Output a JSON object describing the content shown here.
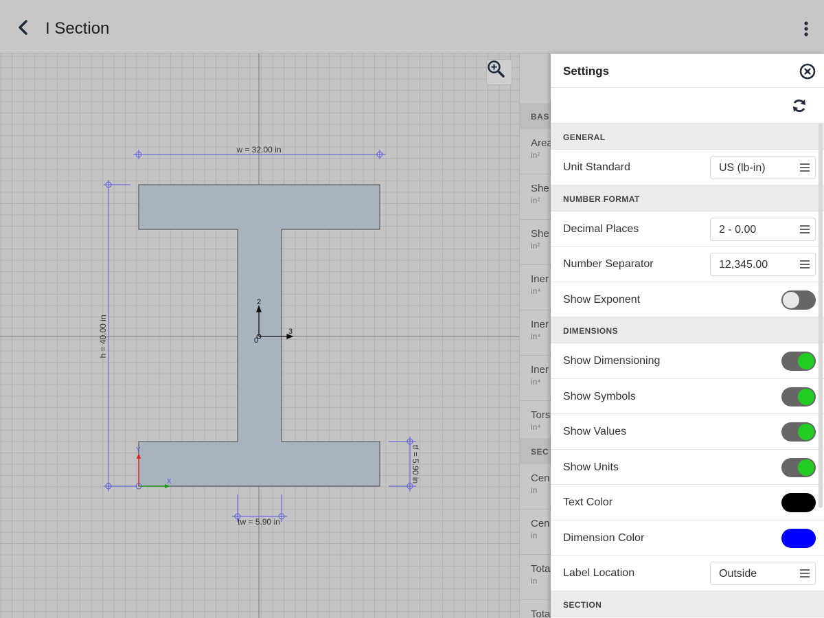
{
  "app": {
    "title": "I Section"
  },
  "colors": {
    "toggle_on": "#22cc22",
    "text_color": "#000000",
    "dimension_color": "#0000ff",
    "section_fill": "#a9b3be",
    "dimension_line": "#5a5adc"
  },
  "canvas": {
    "width_label": "w = 32.00 in",
    "height_label": "h = 40.00 in",
    "tf_label": "tf = 5.90 in",
    "tw_label": "tw = 5.90 in",
    "axis_2": "2",
    "axis_3": "3",
    "origin_label": "0",
    "local_y": "Y",
    "local_x": "X"
  },
  "props": {
    "sections": [
      {
        "label": "BAS"
      },
      {
        "label": "SEC"
      }
    ],
    "rows": [
      {
        "name": "Area",
        "unit": "in²"
      },
      {
        "name": "She",
        "unit": "in²"
      },
      {
        "name": "She",
        "unit": "in²"
      },
      {
        "name": "Iner",
        "unit": "in⁴"
      },
      {
        "name": "Iner",
        "unit": "in⁴"
      },
      {
        "name": "Iner",
        "unit": "in⁴"
      },
      {
        "name": "Tors",
        "unit": "in⁴"
      },
      {
        "name": "Cen",
        "unit": "in"
      },
      {
        "name": "Cen",
        "unit": "in"
      },
      {
        "name": "Tota",
        "unit": "in"
      },
      {
        "name": "Tota",
        "unit": ""
      }
    ]
  },
  "settings": {
    "title": "Settings",
    "general": {
      "header": "GENERAL",
      "unit_standard": {
        "label": "Unit Standard",
        "value": "US (lb-in)"
      }
    },
    "number_format": {
      "header": "NUMBER FORMAT",
      "decimal_places": {
        "label": "Decimal Places",
        "value": "2 - 0.00"
      },
      "number_separator": {
        "label": "Number Separator",
        "value": "12,345.00"
      },
      "show_exponent": {
        "label": "Show Exponent",
        "on": false
      }
    },
    "dimensions": {
      "header": "DIMENSIONS",
      "show_dimensioning": {
        "label": "Show Dimensioning",
        "on": true
      },
      "show_symbols": {
        "label": "Show Symbols",
        "on": true
      },
      "show_values": {
        "label": "Show Values",
        "on": true
      },
      "show_units": {
        "label": "Show Units",
        "on": true
      },
      "text_color": {
        "label": "Text Color"
      },
      "dimension_color": {
        "label": "Dimension Color"
      },
      "label_location": {
        "label": "Label Location",
        "value": "Outside"
      }
    },
    "section": {
      "header": "SECTION"
    }
  }
}
